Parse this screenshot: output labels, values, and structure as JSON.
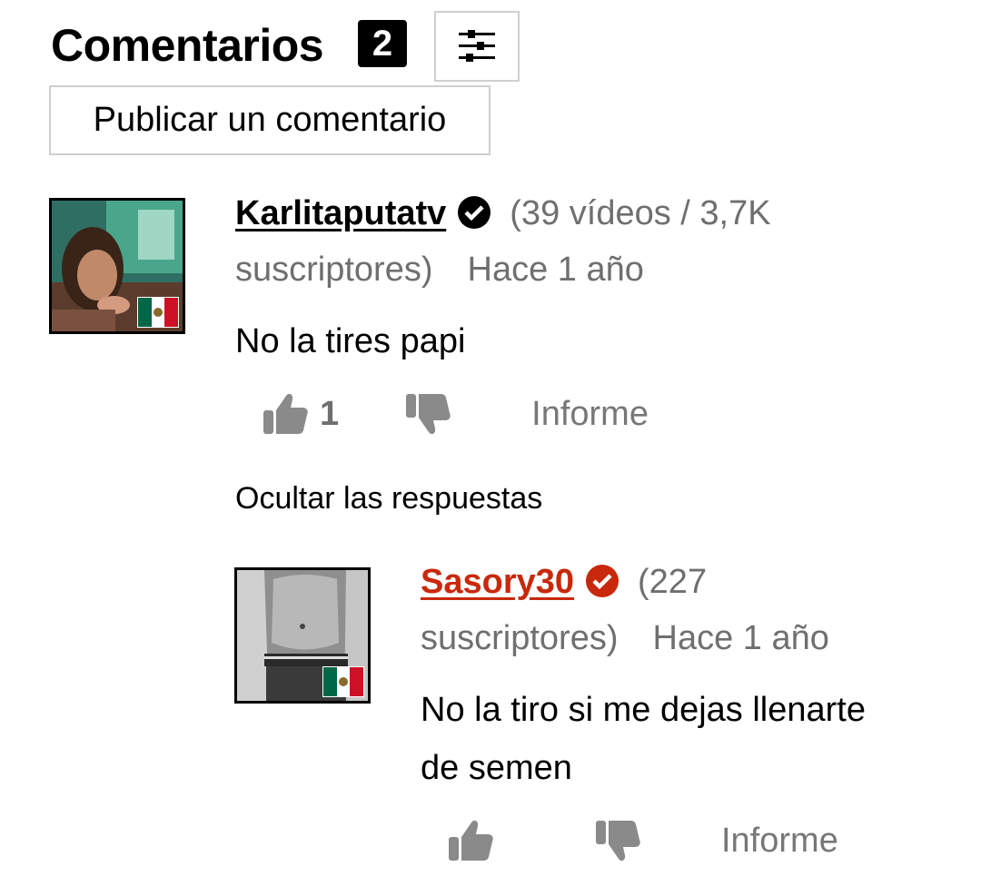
{
  "header": {
    "title": "Comentarios",
    "count": "2",
    "post_button_label": "Publicar un comentario"
  },
  "comments": [
    {
      "username": "Karlitaputatv",
      "stats": "(39 vídeos / 3,7K",
      "stats_line2": "suscriptores)",
      "time": "Hace 1 año",
      "text": "No la tires papi",
      "likes": "1",
      "report_label": "Informe",
      "flag": "mexico-flag",
      "verified_color": "#000000"
    }
  ],
  "replies_toggle_label": "Ocultar las respuestas",
  "replies": [
    {
      "username": "Sasory30",
      "stats": "(227",
      "stats_line2": "suscriptores)",
      "time": "Hace 1 año",
      "text_line1": "No la tiro si me dejas llenarte",
      "text_line2": "de semen",
      "likes": "",
      "report_label": "Informe",
      "flag": "mexico-flag",
      "verified_color": "#c8290c"
    }
  ]
}
